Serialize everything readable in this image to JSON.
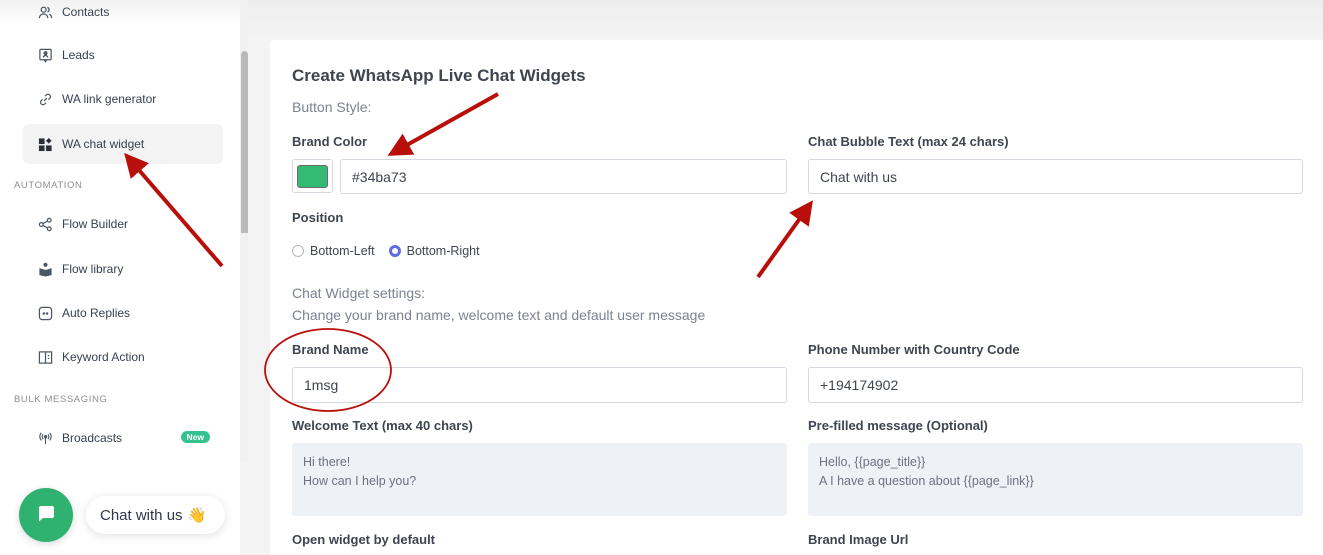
{
  "sidebar": {
    "items": [
      {
        "label": "Contacts",
        "icon": "users-icon"
      },
      {
        "label": "Leads",
        "icon": "lead-card-icon"
      },
      {
        "label": "WA link generator",
        "icon": "link-icon"
      },
      {
        "label": "WA chat widget",
        "icon": "widgets-icon",
        "active": true
      },
      {
        "label": "Flow Builder",
        "icon": "share-nodes-icon"
      },
      {
        "label": "Flow library",
        "icon": "book-reader-icon"
      },
      {
        "label": "Auto Replies",
        "icon": "chat-dots-icon"
      },
      {
        "label": "Keyword Action",
        "icon": "panel-list-icon"
      },
      {
        "label": "Broadcasts",
        "icon": "broadcast-icon",
        "badge": "New"
      }
    ],
    "sections": {
      "automation": "AUTOMATION",
      "bulk_messaging": "BULK MESSAGING"
    }
  },
  "chat_preview": {
    "bubble_text": "Chat with us",
    "wave_emoji": "👋",
    "fab_icon": "chat-message-icon"
  },
  "form": {
    "title": "Create WhatsApp Live Chat Widgets",
    "button_style_label": "Button Style:",
    "brand_color": {
      "label": "Brand Color",
      "value": "#34ba73",
      "swatch_color": "#34ba73"
    },
    "chat_bubble_text": {
      "label": "Chat Bubble Text (max 24 chars)",
      "value": "Chat with us"
    },
    "position": {
      "label": "Position",
      "options": [
        "Bottom-Left",
        "Bottom-Right"
      ],
      "selected": "Bottom-Right"
    },
    "widget_settings_heading": "Chat Widget settings:",
    "widget_settings_desc": "Change your brand name, welcome text and default user message",
    "brand_name": {
      "label": "Brand Name",
      "value": "1msg"
    },
    "phone_number": {
      "label": "Phone Number with Country Code",
      "value": "+194174902"
    },
    "welcome_text": {
      "label": "Welcome Text (max 40 chars)",
      "value": "Hi there!\nHow can I help you?"
    },
    "prefilled_message": {
      "label": "Pre-filled message (Optional)",
      "value": "Hello, {{page_title}}\nA I have a question about {{page_link}}"
    },
    "open_widget_label": "Open widget by default",
    "brand_image_label": "Brand Image Url"
  },
  "colors": {
    "accent_green": "#34ba73",
    "radio_accent": "#5b6ee1",
    "badge_green": "#34c38f",
    "annotation_red": "#b80f0a"
  }
}
